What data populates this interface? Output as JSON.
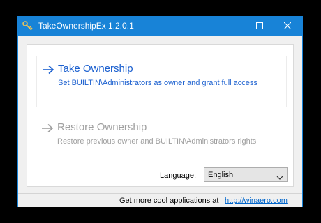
{
  "window": {
    "title": "TakeOwnershipEx 1.2.0.1",
    "accent_color": "#1883d7",
    "icons": {
      "app": "key-app-icon",
      "minimize": "minimize-icon",
      "maximize": "maximize-icon",
      "close": "close-icon"
    }
  },
  "commands": {
    "take": {
      "title": "Take Ownership",
      "description": "Set BUILTIN\\Administrators as owner and grant full access",
      "color": "#1a5fcf",
      "icon": "arrow-right-icon",
      "enabled": true
    },
    "restore": {
      "title": "Restore Ownership",
      "description": "Restore previous owner and BUILTIN\\Administrators rights",
      "color": "#a0a0a0",
      "icon": "arrow-right-icon",
      "enabled": false
    }
  },
  "language": {
    "label": "Language:",
    "selected": "English"
  },
  "status": {
    "text": "Get more cool applications at",
    "link": "http://winaero.com"
  }
}
